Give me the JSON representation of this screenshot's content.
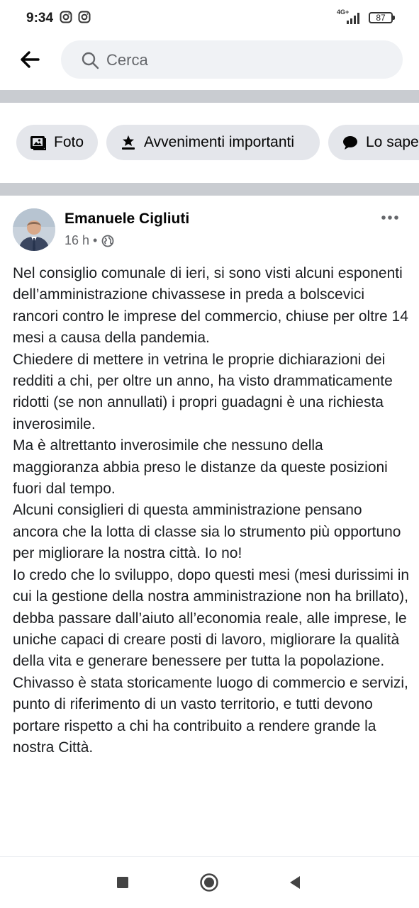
{
  "status_bar": {
    "time": "9:34",
    "network": "4G+",
    "battery": "87",
    "icons": [
      "instagram-icon",
      "instagram-icon",
      "signal-icon",
      "battery-icon"
    ]
  },
  "top_bar": {
    "back_icon": "back-arrow-icon",
    "search_placeholder": "Cerca"
  },
  "chips": [
    {
      "label": "Foto",
      "icon": "photo-icon"
    },
    {
      "label": "Avvenimenti importanti",
      "icon": "flag-icon"
    },
    {
      "label": "Lo sape",
      "icon": "chat-bubble-icon"
    }
  ],
  "post": {
    "author": "Emanuele Cigliuti",
    "time": "16 h",
    "separator": "•",
    "privacy_icon": "globe-icon",
    "more_icon": "more-options-icon",
    "paragraphs": [
      "Nel consiglio comunale di ieri, si sono visti alcuni esponenti dell’amministrazione chivassese in preda a bolscevici rancori contro le imprese del commercio, chiuse per oltre 14 mesi a causa della pandemia.",
      "Chiedere di mettere in vetrina le proprie dichiarazioni dei redditi a chi, per oltre un anno, ha visto drammaticamente ridotti (se non annullati) i propri guadagni è una richiesta inverosimile.",
      "Ma è altrettanto inverosimile che nessuno della maggioranza abbia preso le distanze da queste posizioni fuori dal tempo.",
      "Alcuni consiglieri di questa amministrazione pensano ancora che la lotta di classe sia lo strumento più opportuno per migliorare la nostra città. Io no!",
      "Io credo che lo sviluppo, dopo questi mesi (mesi durissimi in cui la gestione della nostra amministrazione non ha brillato), debba passare dall’aiuto all’economia reale, alle imprese, le uniche capaci di creare posti di lavoro, migliorare la qualità della vita e generare benessere per tutta la popolazione.",
      "Chivasso è stata storicamente luogo di commercio e servizi, punto di riferimento di un vasto territorio, e tutti devono portare rispetto a chi ha contribuito a rendere grande la nostra Città."
    ]
  },
  "nav_bar": {
    "icons": [
      "recent-apps-icon",
      "home-icon",
      "back-triangle-icon"
    ]
  }
}
